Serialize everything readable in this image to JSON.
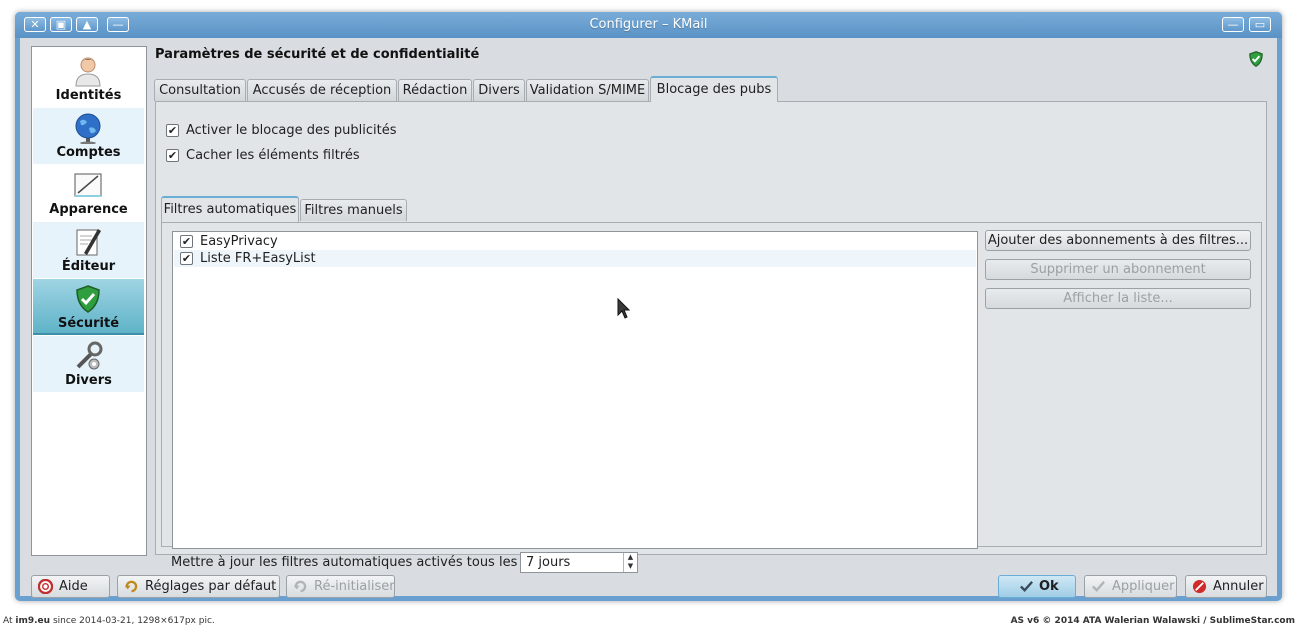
{
  "window": {
    "title": "Configurer – KMail",
    "buttons": [
      "✕",
      "▣",
      "▲",
      "—"
    ],
    "right_buttons": [
      "—",
      "▭"
    ]
  },
  "sidebar": {
    "items": [
      {
        "label": "Identités",
        "icon": "person-icon"
      },
      {
        "label": "Comptes",
        "icon": "globe-icon"
      },
      {
        "label": "Apparence",
        "icon": "palette-icon"
      },
      {
        "label": "Éditeur",
        "icon": "pen-icon"
      },
      {
        "label": "Sécurité",
        "icon": "shield-icon",
        "selected": true
      },
      {
        "label": "Divers",
        "icon": "tools-icon"
      }
    ]
  },
  "page": {
    "title": "Paramètres de sécurité et de confidentialité"
  },
  "tabs": [
    {
      "label": "Consultation"
    },
    {
      "label": "Accusés de réception"
    },
    {
      "label": "Rédaction"
    },
    {
      "label": "Divers"
    },
    {
      "label": "Validation S/MIME"
    },
    {
      "label": "Blocage des pubs",
      "active": true
    }
  ],
  "options": {
    "enable_adblock": {
      "label": "Activer le blocage des publicités",
      "checked": true
    },
    "hide_filtered": {
      "label": "Cacher les éléments filtrés",
      "checked": true
    }
  },
  "subtabs": [
    {
      "label": "Filtres automatiques",
      "active": true
    },
    {
      "label": "Filtres manuels"
    }
  ],
  "filters": [
    {
      "label": "EasyPrivacy",
      "checked": true
    },
    {
      "label": "Liste FR+EasyList",
      "checked": true
    }
  ],
  "filter_buttons": {
    "add": "Ajouter des abonnements à des filtres...",
    "remove": "Supprimer un abonnement",
    "show": "Afficher la liste..."
  },
  "update": {
    "label": "Mettre à jour les filtres automatiques activés tous les :",
    "value": "7 jours"
  },
  "bottom_buttons": {
    "help": "Aide",
    "defaults": "Réglages par défaut",
    "reset": "Ré-initialiser",
    "ok": "Ok",
    "apply": "Appliquer",
    "cancel": "Annuler"
  },
  "footer": {
    "left_prefix": "At",
    "left_site": "im9.eu",
    "left_rest": "since 2014-03-21, 1298×617px pic.",
    "right": "AS v6 © 2014 ATA Walerian Walawski / SublimeStar.com"
  },
  "colors": {
    "titlebar": "#6aa0d0",
    "selection": "#5fb3c8",
    "shield": "#2e9e3e"
  }
}
